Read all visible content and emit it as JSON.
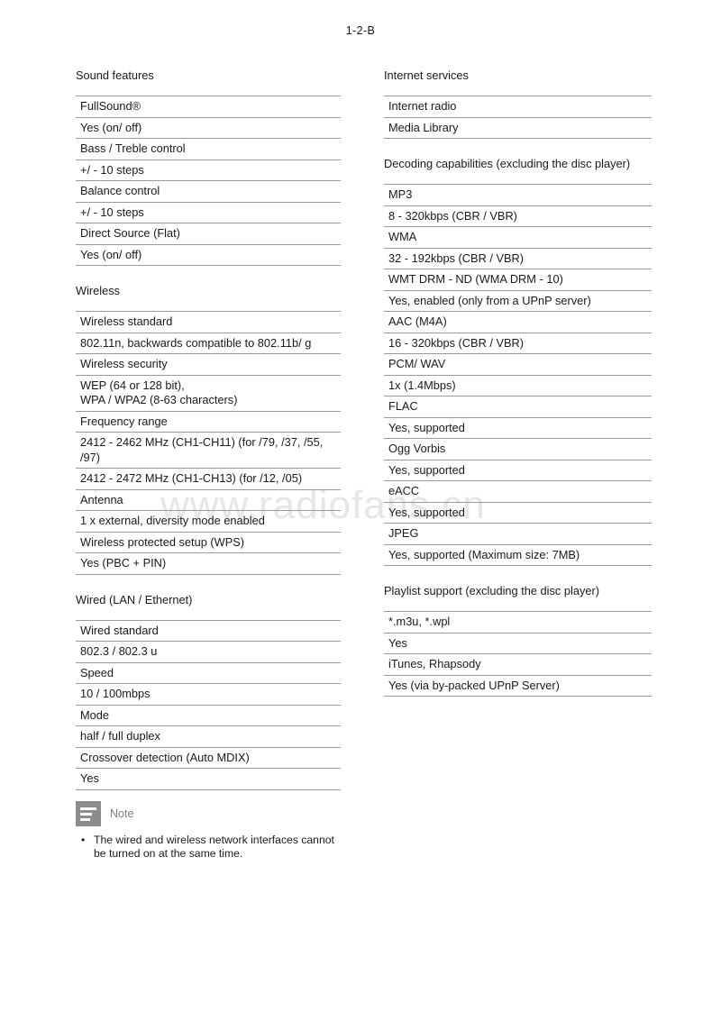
{
  "header": {
    "running_head": "1-2-B"
  },
  "watermark": {
    "text": "www.radiofans.cn",
    "color": "#e6e6e6"
  },
  "left_column": {
    "sections": [
      {
        "title": "Sound features",
        "rows": [
          "FullSound®",
          "Yes (on/ off)",
          "Bass / Treble control",
          "+/ - 10 steps",
          "Balance control",
          "+/ - 10 steps",
          "Direct Source (Flat)",
          "Yes (on/ off)"
        ]
      },
      {
        "title": "Wireless",
        "rows": [
          "Wireless standard",
          "802.11n, backwards compatible to 802.11b/ g",
          "Wireless security",
          "WEP (64 or 128 bit),\nWPA / WPA2 (8-63 characters)",
          "Frequency range",
          "2412 - 2462 MHz (CH1-CH11) (for /79, /37, /55, /97)",
          "2412 - 2472 MHz (CH1-CH13) (for /12, /05)",
          "Antenna",
          "1 x external, diversity mode enabled",
          "Wireless protected setup (WPS)",
          "Yes (PBC + PIN)"
        ]
      },
      {
        "title": "Wired (LAN / Ethernet)",
        "rows": [
          "Wired standard",
          "802.3 / 802.3 u",
          "Speed",
          "10 / 100mbps",
          "Mode",
          "half / full duplex",
          "Crossover detection (Auto MDIX)",
          "Yes"
        ]
      }
    ]
  },
  "right_column": {
    "sections": [
      {
        "title": "Internet services",
        "rows": [
          "Internet radio",
          "Media Library"
        ]
      },
      {
        "title": "Decoding capabilities (excluding the disc player)",
        "rows": [
          "MP3",
          "8 - 320kbps (CBR / VBR)",
          "WMA",
          "32 - 192kbps (CBR / VBR)",
          "WMT DRM - ND (WMA DRM - 10)",
          "Yes, enabled (only from a UPnP server)",
          "AAC (M4A)",
          "16 - 320kbps (CBR / VBR)",
          "PCM/ WAV",
          "1x (1.4Mbps)",
          "FLAC",
          "Yes, supported",
          "Ogg Vorbis",
          "Yes, supported",
          "eACC",
          "Yes, supported",
          "JPEG",
          "Yes, supported (Maximum size: 7MB)"
        ]
      },
      {
        "title": "Playlist support (excluding the disc player)",
        "rows": [
          "*.m3u, *.wpl",
          "Yes",
          "iTunes, Rhapsody",
          "Yes (via by-packed UPnP Server)"
        ]
      }
    ]
  },
  "note": {
    "icon": "note-lines-icon",
    "label": "Note",
    "bullet_char": "•",
    "items": [
      "The wired and wireless network interfaces cannot be turned on at the same time."
    ]
  }
}
